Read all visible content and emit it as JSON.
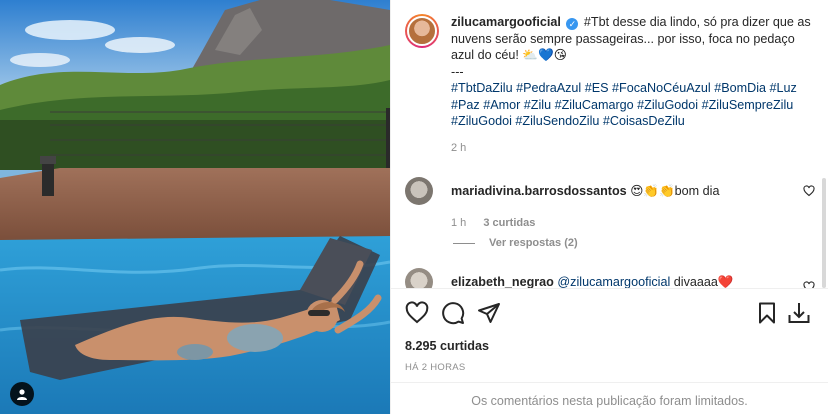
{
  "post": {
    "caption": {
      "username": "zilucamargooficial",
      "text": "#Tbt desse dia lindo, só pra dizer que as nuvens serão sempre passageiras... por isso, foca no pedaço azul do céu! ⛅💙😘",
      "separator": "---",
      "hashtags": "#TbtDaZilu #PedraAzul #ES #FocaNoCéuAzul #BomDia #Luz #Paz #Amor #Zilu #ZiluCamargo #ZiluGodoi #ZiluSempreZilu #ZiluGodoi #ZiluSendoZilu #CoisasDeZilu",
      "time": "2 h"
    },
    "comments": [
      {
        "username": "mariadivina.barrosdossantos",
        "text": "😍👏👏bom dia",
        "time": "1 h",
        "likes": "3 curtidas",
        "replies": "Ver respostas (2)"
      },
      {
        "username": "elizabeth_negrao",
        "mention": "@zilucamargooficial",
        "text": "divaaaa❤️"
      }
    ],
    "likes": "8.295 curtidas",
    "posted_ago": "HÁ 2 HORAS",
    "comments_limited": "Os comentários nesta publicação foram limitados."
  },
  "icons": {
    "like": "heart-icon",
    "comment": "comment-icon",
    "share": "paper-plane-icon",
    "save": "bookmark-icon",
    "download": "download-icon",
    "user_tag": "user-icon"
  },
  "colors": {
    "link": "#00376b",
    "muted": "#8e8e8e",
    "verified": "#3897f0"
  }
}
